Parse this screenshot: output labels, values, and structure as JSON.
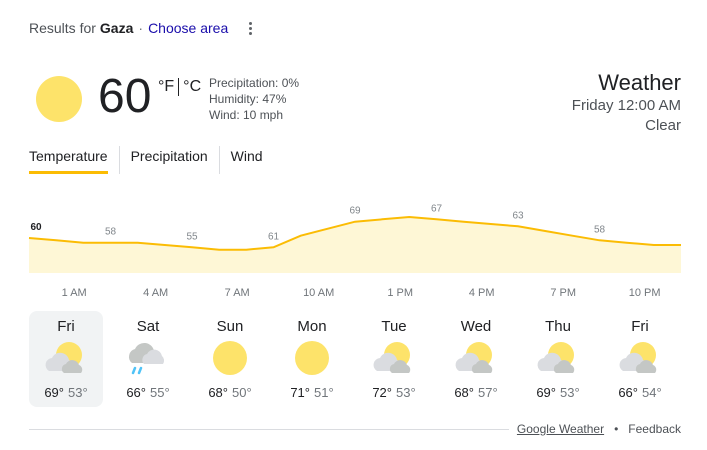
{
  "header": {
    "results_prefix": "Results for",
    "location": "Gaza",
    "separator": "·",
    "choose_area": "Choose area"
  },
  "current": {
    "temp": "60",
    "unit_f": "°F",
    "unit_c": "°C",
    "precipitation": "Precipitation: 0%",
    "humidity": "Humidity: 47%",
    "wind": "Wind: 10 mph",
    "icon": "sun-icon",
    "sun_color": "#fde36a"
  },
  "summary": {
    "title": "Weather",
    "datetime": "Friday 12:00 AM",
    "condition": "Clear"
  },
  "tabs": [
    {
      "label": "Temperature",
      "active": true
    },
    {
      "label": "Precipitation",
      "active": false
    },
    {
      "label": "Wind",
      "active": false
    }
  ],
  "chart_data": {
    "type": "area",
    "x": [
      "12 AM",
      "1 AM",
      "2 AM",
      "3 AM",
      "4 AM",
      "5 AM",
      "6 AM",
      "7 AM",
      "8 AM",
      "9 AM",
      "10 AM",
      "11 AM",
      "12 PM",
      "1 PM",
      "2 PM",
      "3 PM",
      "4 PM",
      "5 PM",
      "6 PM",
      "7 PM",
      "8 PM",
      "9 PM",
      "10 PM",
      "11 PM",
      "12 AM"
    ],
    "values": [
      60,
      59,
      58,
      58,
      58,
      57,
      56,
      55,
      55,
      56,
      61,
      64,
      67,
      68,
      69,
      68,
      67,
      66,
      65,
      63,
      61,
      59,
      58,
      57,
      57
    ],
    "labels": [
      {
        "index": 0,
        "text": "60"
      },
      {
        "index": 3,
        "text": "58"
      },
      {
        "index": 6,
        "text": "55"
      },
      {
        "index": 9,
        "text": "61"
      },
      {
        "index": 12,
        "text": "69"
      },
      {
        "index": 15,
        "text": "67"
      },
      {
        "index": 18,
        "text": "63"
      },
      {
        "index": 21,
        "text": "58"
      }
    ],
    "tick_labels": [
      {
        "index": 1,
        "text": "1 AM"
      },
      {
        "index": 4,
        "text": "4 AM"
      },
      {
        "index": 7,
        "text": "7 AM"
      },
      {
        "index": 10,
        "text": "10 AM"
      },
      {
        "index": 13,
        "text": "1 PM"
      },
      {
        "index": 16,
        "text": "4 PM"
      },
      {
        "index": 19,
        "text": "7 PM"
      },
      {
        "index": 22,
        "text": "10 PM"
      }
    ],
    "ylim": [
      45,
      72
    ],
    "line_color": "#fbbc04",
    "fill_color": "#fef7d6"
  },
  "forecast": [
    {
      "day": "Fri",
      "icon": "partly-cloudy-icon",
      "hi": "69°",
      "lo": "53°",
      "selected": true
    },
    {
      "day": "Sat",
      "icon": "rain-showers-icon",
      "hi": "66°",
      "lo": "55°",
      "selected": false
    },
    {
      "day": "Sun",
      "icon": "sun-icon",
      "hi": "68°",
      "lo": "50°",
      "selected": false
    },
    {
      "day": "Mon",
      "icon": "sun-icon",
      "hi": "71°",
      "lo": "51°",
      "selected": false
    },
    {
      "day": "Tue",
      "icon": "partly-cloudy-icon",
      "hi": "72°",
      "lo": "53°",
      "selected": false
    },
    {
      "day": "Wed",
      "icon": "partly-cloudy-icon",
      "hi": "68°",
      "lo": "57°",
      "selected": false
    },
    {
      "day": "Thu",
      "icon": "partly-cloudy-icon",
      "hi": "69°",
      "lo": "53°",
      "selected": false
    },
    {
      "day": "Fri",
      "icon": "partly-cloudy-icon",
      "hi": "66°",
      "lo": "54°",
      "selected": false
    }
  ],
  "footer": {
    "source": "Google Weather",
    "dot": "•",
    "feedback": "Feedback"
  }
}
